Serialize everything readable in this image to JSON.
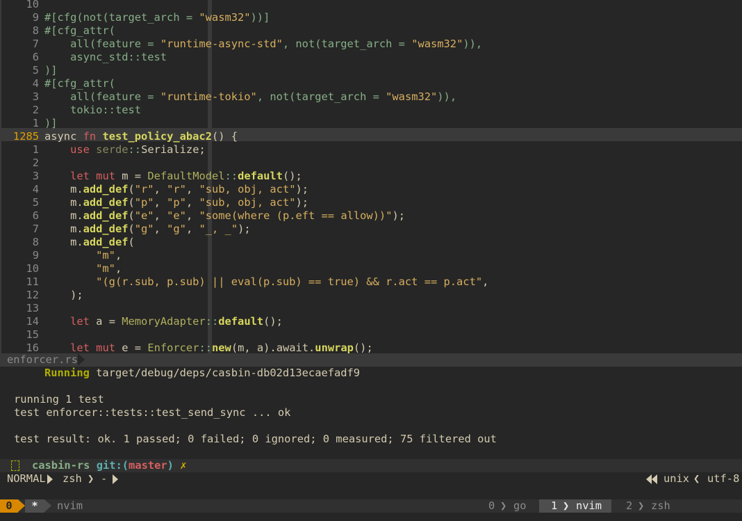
{
  "editor": {
    "lines": [
      {
        "ln": "10",
        "html": ""
      },
      {
        "ln": "9",
        "html": "<span class=\"attr\">#[cfg(not(target_arch = <span class=\"str\">\"wasm32\"</span>))]</span>"
      },
      {
        "ln": "8",
        "html": "<span class=\"attr\">#[cfg_attr(</span>"
      },
      {
        "ln": "7",
        "html": "    <span class=\"attr\">all(feature = <span class=\"str\">\"runtime-async-std\"</span>, not(target_arch = <span class=\"str\">\"wasm32\"</span>)),</span>"
      },
      {
        "ln": "6",
        "html": "    <span class=\"attr\">async_std::test</span>"
      },
      {
        "ln": "5",
        "html": "<span class=\"attr\">)]</span>"
      },
      {
        "ln": "4",
        "html": "<span class=\"attr\">#[cfg_attr(</span>"
      },
      {
        "ln": "3",
        "html": "    <span class=\"attr\">all(feature = <span class=\"str\">\"runtime-tokio\"</span>, not(target_arch = <span class=\"str\">\"wasm32\"</span>)),</span>"
      },
      {
        "ln": "2",
        "html": "    <span class=\"attr\">tokio::test</span>"
      },
      {
        "ln": "1",
        "html": "<span class=\"attr\">)]</span>"
      },
      {
        "ln": "1285",
        "cur": true,
        "html": "async <span class=\"kw\">fn</span> <span class=\"fn\">test_policy_abac2</span>() {"
      },
      {
        "ln": "1",
        "html": "    <span class=\"kw\">use</span> <span class=\"path\">serde</span><span class=\"op\">::</span>Serialize;"
      },
      {
        "ln": "2",
        "html": ""
      },
      {
        "ln": "3",
        "html": "    <span class=\"kw\">let</span> <span class=\"kw\">mut</span> m = <span class=\"ty\">DefaultModel</span><span class=\"op\">::</span><span class=\"fn\">default</span>();"
      },
      {
        "ln": "4",
        "html": "    m.<span class=\"fn\">add_def</span>(<span class=\"str\">\"r\"</span>, <span class=\"str\">\"r\"</span>, <span class=\"str\">\"sub, obj, act\"</span>);"
      },
      {
        "ln": "5",
        "html": "    m.<span class=\"fn\">add_def</span>(<span class=\"str\">\"p\"</span>, <span class=\"str\">\"p\"</span>, <span class=\"str\">\"sub, obj, act\"</span>);"
      },
      {
        "ln": "6",
        "html": "    m.<span class=\"fn\">add_def</span>(<span class=\"str\">\"e\"</span>, <span class=\"str\">\"e\"</span>, <span class=\"str\">\"some(where (p.eft == allow))\"</span>);"
      },
      {
        "ln": "7",
        "html": "    m.<span class=\"fn\">add_def</span>(<span class=\"str\">\"g\"</span>, <span class=\"str\">\"g\"</span>, <span class=\"str\">\"_, _\"</span>);"
      },
      {
        "ln": "8",
        "html": "    m.<span class=\"fn\">add_def</span>("
      },
      {
        "ln": "9",
        "html": "        <span class=\"str\">\"m\"</span>,"
      },
      {
        "ln": "10",
        "html": "        <span class=\"str\">\"m\"</span>,"
      },
      {
        "ln": "11",
        "html": "        <span class=\"str\">\"(g(r.sub, p.sub) || eval(p.sub) == true) &amp;&amp; r.act == p.act\"</span>,"
      },
      {
        "ln": "12",
        "html": "    );"
      },
      {
        "ln": "13",
        "html": ""
      },
      {
        "ln": "14",
        "html": "    <span class=\"kw\">let</span> a = <span class=\"ty\">MemoryAdapter</span><span class=\"op\">::</span><span class=\"fn\">default</span>();"
      },
      {
        "ln": "15",
        "html": ""
      },
      {
        "ln": "16",
        "html": "    <span class=\"kw\">let</span> <span class=\"kw\">mut</span> e = <span class=\"ty\">Enforcer</span><span class=\"op\">::</span><span class=\"fn\">new</span>(m, a).await.<span class=\"fn\">unwrap</span>();"
      }
    ]
  },
  "filebar": {
    "name": "enforcer.rs"
  },
  "terminal": {
    "running_label": "Running",
    "running_path": "target/debug/deps/casbin-db02d13ecaefadf9",
    "line_running": "running 1 test",
    "line_test": "test enforcer::tests::test_send_sync ... ok",
    "line_result": "test result: ok. 1 passed; 0 failed; 0 ignored; 0 measured; 75 filtered out"
  },
  "prompt": {
    "dir": "casbin-rs",
    "git": "git:",
    "branch_open": "(",
    "branch": "master",
    "branch_close": ")",
    "dirty": "✗"
  },
  "status": {
    "mode": "NORMAL",
    "shell": "zsh",
    "dash": "-",
    "fileformat": "unix",
    "encoding": "utf-8"
  },
  "tmux": {
    "session": "0",
    "star": "*",
    "title": "nvim",
    "windows": [
      {
        "idx": "0",
        "name": "go"
      },
      {
        "idx": "1",
        "name": "nvim"
      },
      {
        "idx": "2",
        "name": "zsh"
      }
    ]
  },
  "colors": {
    "keyword": "#d75f5f",
    "string": "#d7af5f",
    "function": "#d7d75f",
    "cursor_line_number": "#e0a000",
    "session": "#d78700"
  }
}
